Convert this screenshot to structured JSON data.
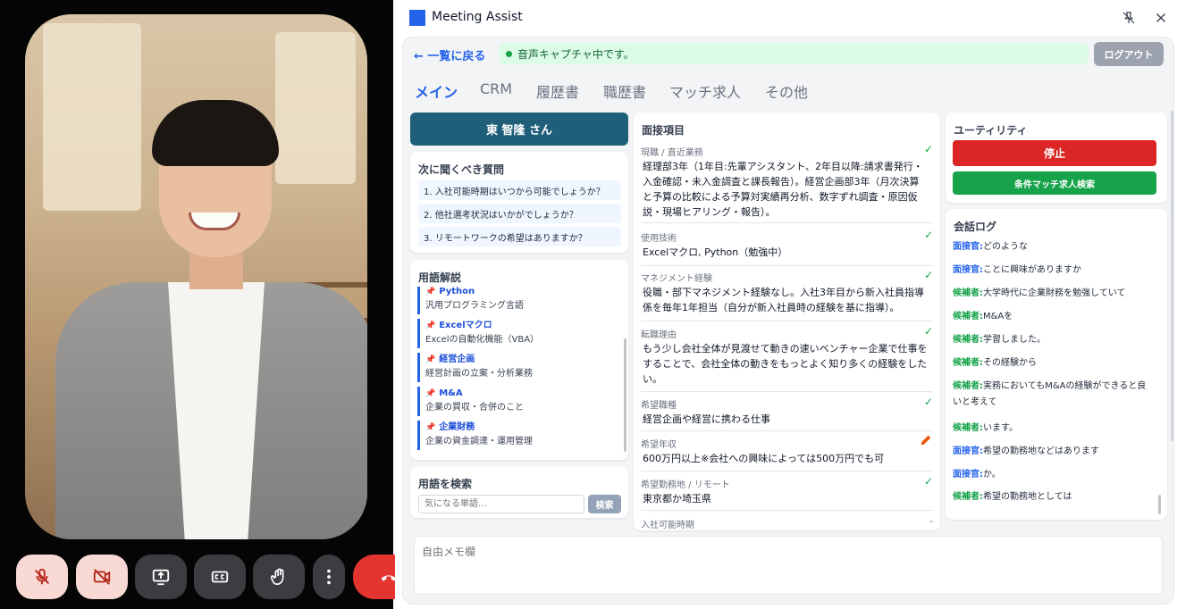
{
  "app": {
    "title": "Meeting Assist",
    "brand_color": "#2563eb"
  },
  "header": {
    "back_label": "← 一覧に戻る",
    "status": "音声キャプチャ中です。",
    "logout_label": "ログアウト"
  },
  "tabs": [
    {
      "label": "メイン",
      "active": true
    },
    {
      "label": "CRM"
    },
    {
      "label": "履歴書"
    },
    {
      "label": "職歴書"
    },
    {
      "label": "マッチ求人"
    },
    {
      "label": "その他"
    }
  ],
  "candidate": {
    "name": "東 智隆 さん"
  },
  "questions": {
    "title": "次に聞くべき質問",
    "items": [
      "1. 入社可能時期はいつから可能でしょうか？",
      "2. 他社選考状況はいかがでしょうか？",
      "3. リモートワークの希望はありますか？"
    ]
  },
  "glossary": {
    "title": "用語解説",
    "items": [
      {
        "term": "Python",
        "desc": "汎用プログラミング言語"
      },
      {
        "term": "Excelマクロ",
        "desc": "Excelの自動化機能（VBA）"
      },
      {
        "term": "経営企画",
        "desc": "経営計画の立案・分析業務"
      },
      {
        "term": "M&A",
        "desc": "企業の買収・合併のこと"
      },
      {
        "term": "企業財務",
        "desc": "企業の資金調達・運用管理"
      }
    ]
  },
  "term_search": {
    "title": "用語を検索",
    "placeholder": "気になる単語...",
    "button": "検索"
  },
  "interview": {
    "title": "面接項目",
    "items": [
      {
        "label": "現職 / 直近業務",
        "status": "done",
        "value": "経理部3年（1年目:先輩アシスタント、2年目以降:請求書発行・入金確認・未入金調査と課長報告）。経営企画部3年（月次決算と予算の比較による予算対実績再分析、数字ずれ調査・原因仮説・現場ヒアリング・報告）。"
      },
      {
        "label": "使用技術",
        "status": "done",
        "value": "Excelマクロ, Python（勉強中）"
      },
      {
        "label": "マネジメント経験",
        "status": "done",
        "value": "役職・部下マネジメント経験なし。入社3年目から新入社員指導係を毎年1年担当（自分が新入社員時の経験を基に指導）。"
      },
      {
        "label": "転職理由",
        "status": "done",
        "value": "もう少し会社全体が見渡せて動きの速いベンチャー企業で仕事をすることで、会社全体の動きをもっとよく知り多くの経験をしたい。"
      },
      {
        "label": "希望職種",
        "status": "done",
        "value": "経営企画や経営に携わる仕事"
      },
      {
        "label": "希望年収",
        "status": "edit",
        "value": "600万円以上※会社への興味によっては500万円でも可"
      },
      {
        "label": "希望勤務地 / リモート",
        "status": "done",
        "value": "東京都か埼玉県"
      },
      {
        "label": "入社可能時期",
        "status": "pending",
        "value": ""
      }
    ],
    "pending_mark": "-"
  },
  "utility": {
    "title": "ユーティリティ",
    "stop_label": "停止",
    "match_label": "条件マッチ求人検索"
  },
  "chat_log": {
    "title": "会話ログ",
    "entries": [
      {
        "speaker": "面接官:",
        "role": "interviewer",
        "text": "どのような"
      },
      {
        "speaker": "面接官:",
        "role": "interviewer",
        "text": "ことに興味がありますか"
      },
      {
        "speaker": "候補者:",
        "role": "candidate",
        "text": "大学時代に企業財務を勉強していて"
      },
      {
        "speaker": "候補者:",
        "role": "candidate",
        "text": "M&Aを"
      },
      {
        "speaker": "候補者:",
        "role": "candidate",
        "text": "学習しました。"
      },
      {
        "speaker": "候補者:",
        "role": "candidate",
        "text": "その経験から"
      },
      {
        "speaker": "候補者:",
        "role": "candidate",
        "text": "実務においてもM&Aの経験ができると良いと考えて"
      },
      {
        "speaker": "候補者:",
        "role": "candidate",
        "text": "います。"
      },
      {
        "speaker": "面接官:",
        "role": "interviewer",
        "text": "希望の勤務地などはあります"
      },
      {
        "speaker": "面接官:",
        "role": "interviewer",
        "text": "か。"
      },
      {
        "speaker": "候補者:",
        "role": "candidate",
        "text": "希望の勤務地としては"
      }
    ]
  },
  "memo": {
    "placeholder": "自由メモ欄"
  },
  "call_controls": {
    "mic": "muted",
    "camera": "off",
    "buttons": [
      "mic-off-icon",
      "camera-off-icon",
      "present-screen-icon",
      "captions-icon",
      "raise-hand-icon",
      "more-options-icon",
      "end-call-icon"
    ],
    "hangup_color": "#e3342f"
  }
}
